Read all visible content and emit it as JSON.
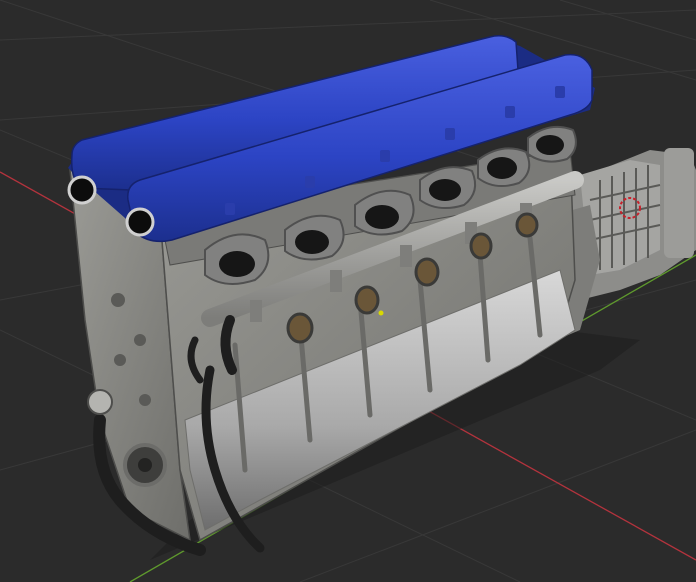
{
  "viewport": {
    "background": "#2b2b2b",
    "grid_color": "#3a3a3a",
    "axis_x_color": "#b3333d",
    "axis_y_color": "#5f9a2d"
  },
  "model": {
    "valve_cover_color": "#2c44c4",
    "block_color": "#8a8a86",
    "shadow_color": "#4e4e4c",
    "hose_color": "#1e1e1e",
    "origin_color": "#d8d800",
    "selection_color": "#c8202a"
  },
  "scene": {
    "object_origin_icon": "origin-dot-icon",
    "transmission_selection_icon": "selection-circle-icon"
  }
}
